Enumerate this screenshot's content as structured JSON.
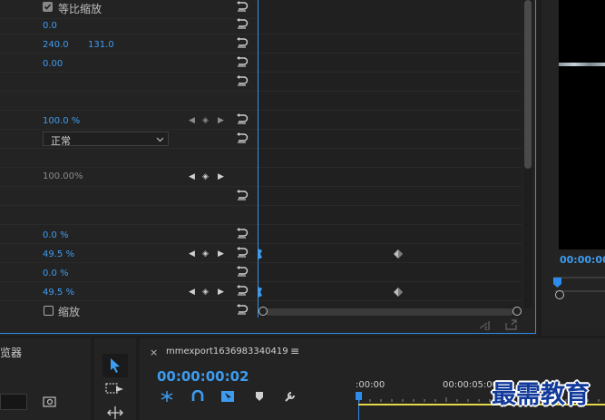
{
  "effect_controls": {
    "uniform_scale_label": "等比缩放",
    "scale_label": "缩放",
    "anchor_x": "0.0",
    "position_x": "240.0",
    "position_y": "131.0",
    "rotation": "0.00",
    "opacity": "100.0 %",
    "blend_mode": "正常",
    "speed": "100.00%",
    "crop_left": "0.0 %",
    "crop_top": "49.5 %",
    "crop_right": "0.0 %",
    "crop_bottom": "49.5 %"
  },
  "program_monitor": {
    "timecode": "00:00:00"
  },
  "project_panel": {
    "title_partial": "览器"
  },
  "sequence": {
    "tab_close": "×",
    "name": "mmexport1636983340419",
    "menu": "≡",
    "timecode": "00:00:00:02",
    "ruler_start": ":00:00",
    "ruler_5s": "00:00:05:00"
  },
  "watermark": "最需教育",
  "colors": {
    "accent": "#2d8ceb",
    "value_blue": "#3d9cf0",
    "playhead_yellow": "#e6d84a",
    "panel_bg": "#232323"
  }
}
